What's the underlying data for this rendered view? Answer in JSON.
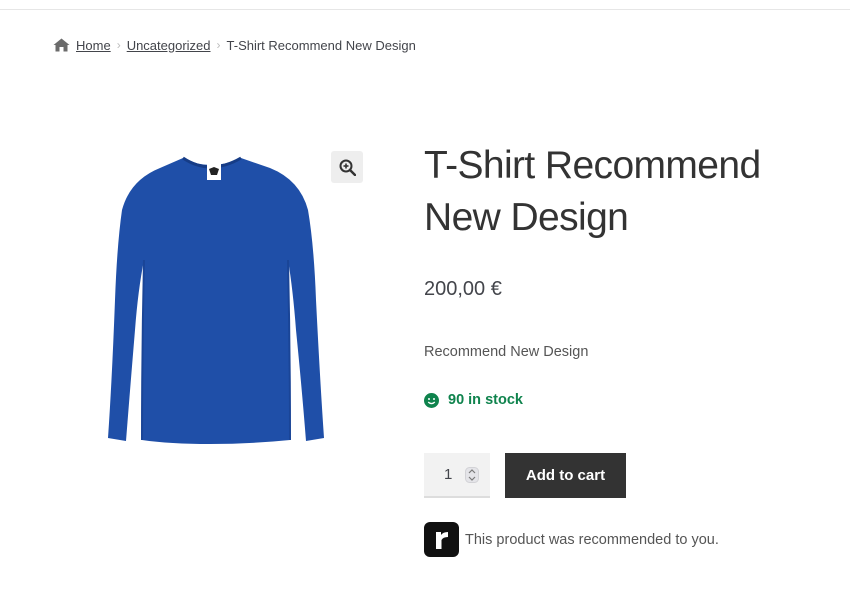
{
  "breadcrumb": {
    "home_icon": "home-icon",
    "home": "Home",
    "category": "Uncategorized",
    "current": "T-Shirt Recommend New Design",
    "separator": "›"
  },
  "product": {
    "title": "T-Shirt Recommend New Design",
    "price": "200,00 €",
    "description": "Recommend New Design",
    "stock": "90 in stock",
    "stock_icon": "smile-icon",
    "quantity": "1",
    "add_to_cart": "Add to cart",
    "zoom_icon": "zoom-in-icon",
    "image_alt": "Royal blue long-sleeve t-shirt"
  },
  "recommendation": {
    "logo_icon": "recommend-logo-icon",
    "text": "This product was recommended to you."
  },
  "colors": {
    "shirt": "#1f4fa8",
    "stock_green": "#0f834d",
    "button": "#333333"
  }
}
